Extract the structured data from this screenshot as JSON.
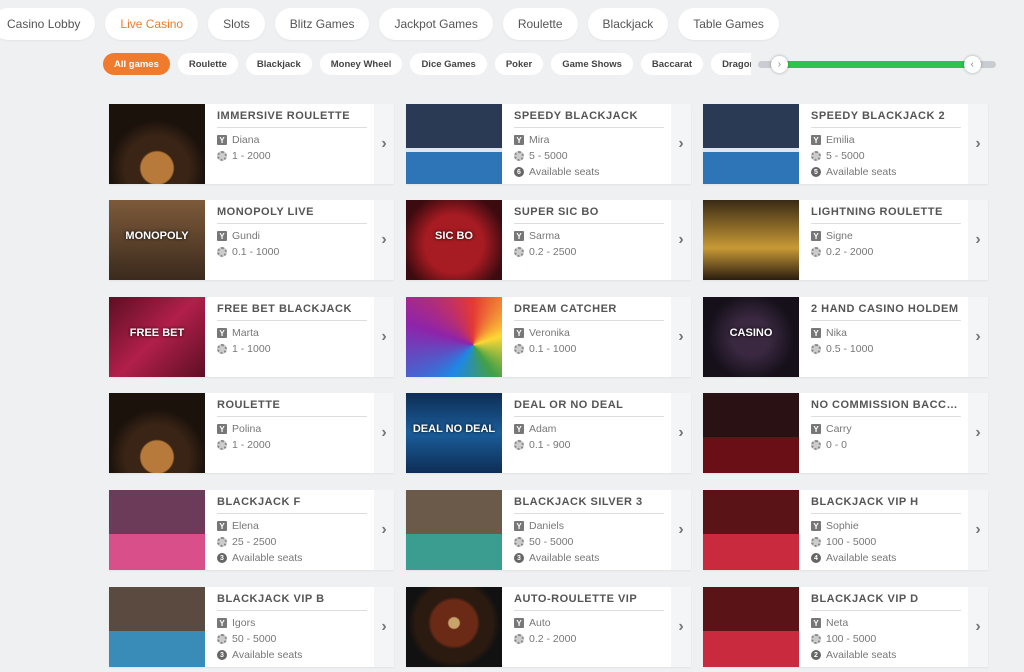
{
  "top_nav": [
    {
      "label": "Casino Lobby",
      "active": false
    },
    {
      "label": "Live Casino",
      "active": true
    },
    {
      "label": "Slots",
      "active": false
    },
    {
      "label": "Blitz Games",
      "active": false
    },
    {
      "label": "Jackpot Games",
      "active": false
    },
    {
      "label": "Roulette",
      "active": false
    },
    {
      "label": "Blackjack",
      "active": false
    },
    {
      "label": "Table Games",
      "active": false
    }
  ],
  "filters": [
    {
      "label": "All games",
      "active": true
    },
    {
      "label": "Roulette",
      "active": false
    },
    {
      "label": "Blackjack",
      "active": false
    },
    {
      "label": "Money Wheel",
      "active": false
    },
    {
      "label": "Dice Games",
      "active": false
    },
    {
      "label": "Poker",
      "active": false
    },
    {
      "label": "Game Shows",
      "active": false
    },
    {
      "label": "Baccarat",
      "active": false
    },
    {
      "label": "Dragon Tiger",
      "active": false
    }
  ],
  "range_slider": {
    "fill_start_fraction": 0.09,
    "fill_end_fraction": 0.9,
    "left_arrow": "›",
    "right_arrow": "‹"
  },
  "icons": {
    "dealer": "dealer-icon",
    "limits": "chip-icon",
    "seats": "seat-icon",
    "arrow": "chevron-right-icon"
  },
  "colors": {
    "accent": "#f07b2c",
    "slider_fill": "#2fc34e"
  },
  "arrow_glyph": "›",
  "games": [
    {
      "title": "IMMERSIVE ROULETTE",
      "dealer": "Diana",
      "limits": "1 - 2000",
      "seats": null,
      "thumb": "t-roul",
      "thumb_label": ""
    },
    {
      "title": "SPEEDY BLACKJACK",
      "dealer": "Mira",
      "limits": "5 - 5000",
      "seats": "6",
      "thumb": "t-bj-speedy",
      "thumb_label": ""
    },
    {
      "title": "SPEEDY BLACKJACK 2",
      "dealer": "Emilia",
      "limits": "5 - 5000",
      "seats": "5",
      "thumb": "t-bj-speedy",
      "thumb_label": ""
    },
    {
      "title": "MONOPOLY LIVE",
      "dealer": "Gundi",
      "limits": "0.1 - 1000",
      "seats": null,
      "thumb": "t-mono",
      "thumb_label": "MONOPOLY"
    },
    {
      "title": "SUPER SIC BO",
      "dealer": "Sarma",
      "limits": "0.2 - 2500",
      "seats": null,
      "thumb": "t-sicbo",
      "thumb_label": "SIC BO"
    },
    {
      "title": "LIGHTNING ROULETTE",
      "dealer": "Signe",
      "limits": "0.2 - 2000",
      "seats": null,
      "thumb": "t-lightning",
      "thumb_label": ""
    },
    {
      "title": "FREE BET BLACKJACK",
      "dealer": "Marta",
      "limits": "1 - 1000",
      "seats": null,
      "thumb": "t-freebet",
      "thumb_label": "FREE BET"
    },
    {
      "title": "DREAM CATCHER",
      "dealer": "Veronika",
      "limits": "0.1 - 1000",
      "seats": null,
      "thumb": "t-dream",
      "thumb_label": ""
    },
    {
      "title": "2 HAND CASINO HOLDEM",
      "dealer": "Nika",
      "limits": "0.5 - 1000",
      "seats": null,
      "thumb": "t-holdem",
      "thumb_label": "CASINO"
    },
    {
      "title": "ROULETTE",
      "dealer": "Polina",
      "limits": "1 - 2000",
      "seats": null,
      "thumb": "t-roul",
      "thumb_label": ""
    },
    {
      "title": "DEAL OR NO DEAL",
      "dealer": "Adam",
      "limits": "0.1 - 900",
      "seats": null,
      "thumb": "t-deal",
      "thumb_label": "DEAL NO DEAL"
    },
    {
      "title": "NO COMMISSION BACCARAT",
      "dealer": "Carry",
      "limits": "0 - 0",
      "seats": null,
      "thumb": "t-nocomm",
      "thumb_label": ""
    },
    {
      "title": "BLACKJACK F",
      "dealer": "Elena",
      "limits": "25 - 2500",
      "seats": "3",
      "thumb": "t-bjf",
      "thumb_label": ""
    },
    {
      "title": "BLACKJACK SILVER 3",
      "dealer": "Daniels",
      "limits": "50 - 5000",
      "seats": "3",
      "thumb": "t-silver",
      "thumb_label": ""
    },
    {
      "title": "BLACKJACK VIP H",
      "dealer": "Sophie",
      "limits": "100 - 5000",
      "seats": "4",
      "thumb": "t-vip-red",
      "thumb_label": ""
    },
    {
      "title": "BLACKJACK VIP B",
      "dealer": "Igors",
      "limits": "50 - 5000",
      "seats": "3",
      "thumb": "t-vipb",
      "thumb_label": ""
    },
    {
      "title": "AUTO-ROULETTE VIP",
      "dealer": "Auto",
      "limits": "0.2 - 2000",
      "seats": null,
      "thumb": "t-auto",
      "thumb_label": ""
    },
    {
      "title": "BLACKJACK VIP D",
      "dealer": "Neta",
      "limits": "100 - 5000",
      "seats": "2",
      "thumb": "t-vip-red",
      "thumb_label": ""
    }
  ],
  "seats_label": "Available seats"
}
